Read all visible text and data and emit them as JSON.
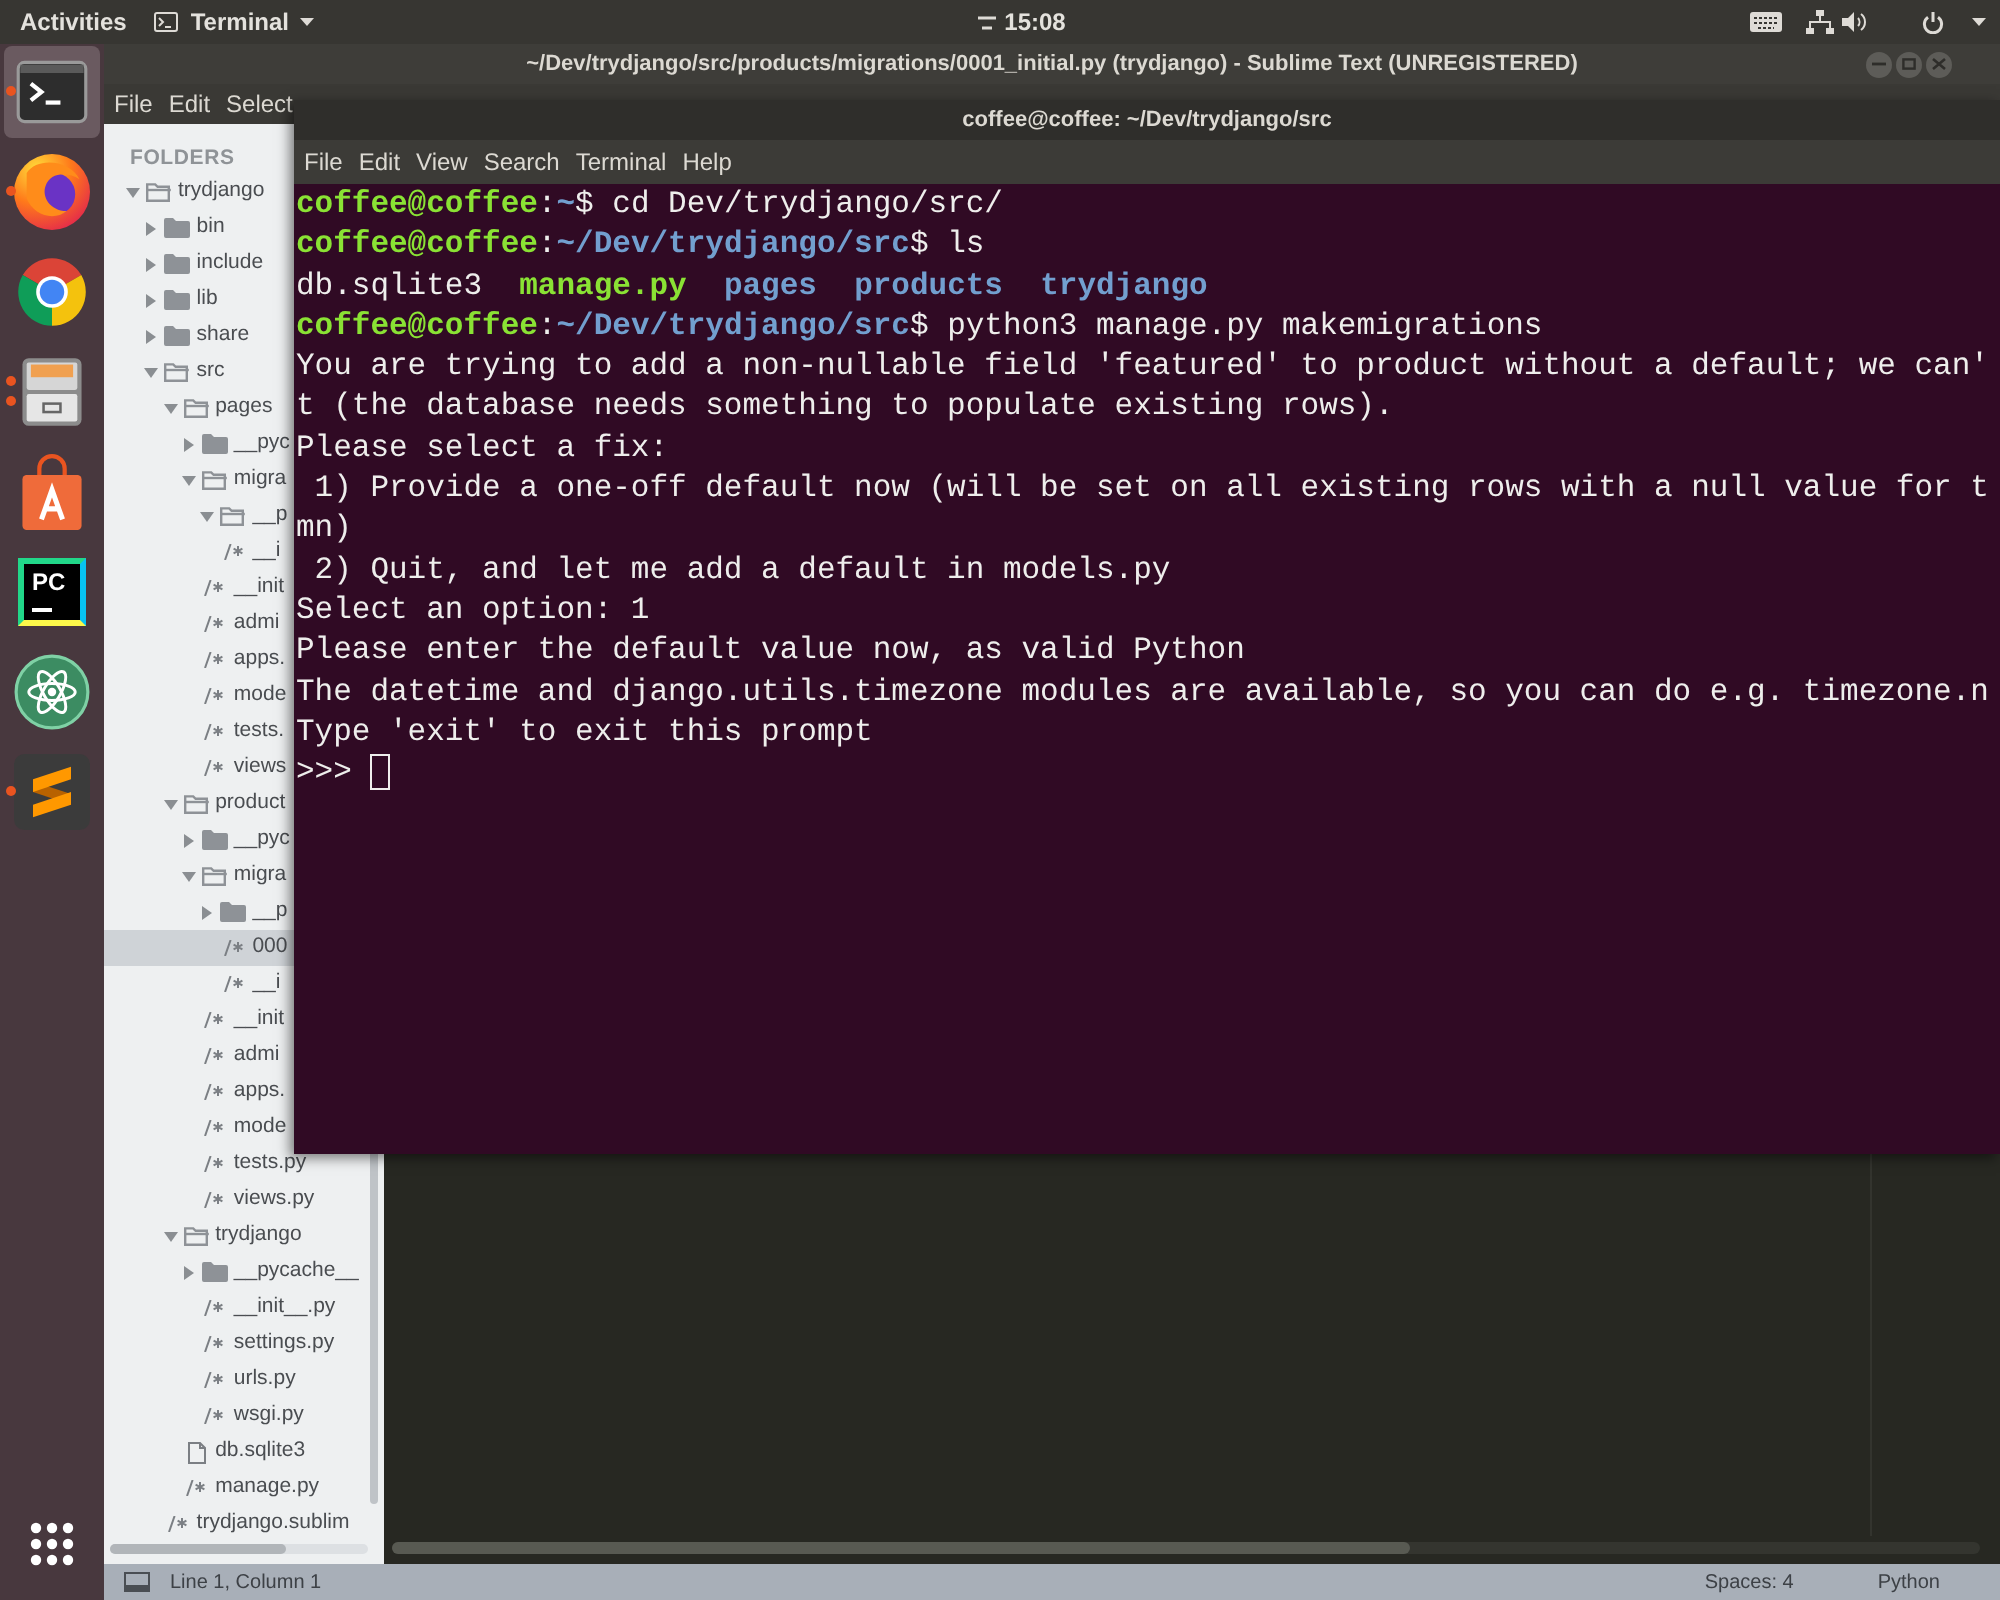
{
  "top_bar": {
    "activities": "Activities",
    "app_menu": "Terminal",
    "clock": "15:08"
  },
  "dock": {
    "items": [
      {
        "kind": "terminal",
        "selected": true,
        "running": true,
        "multiple": false
      },
      {
        "kind": "firefox",
        "selected": false,
        "running": true,
        "multiple": false
      },
      {
        "kind": "chrome",
        "selected": false,
        "running": false
      },
      {
        "kind": "files",
        "selected": false,
        "running": true,
        "multiple": true
      },
      {
        "kind": "software",
        "selected": false,
        "running": false
      },
      {
        "kind": "pycharm",
        "selected": false,
        "running": false,
        "logo_text": "PC"
      },
      {
        "kind": "atom",
        "selected": false,
        "running": false
      },
      {
        "kind": "sublime",
        "selected": false,
        "running": true,
        "multiple": false
      }
    ]
  },
  "editor_window": {
    "title": "~/Dev/trydjango/src/products/migrations/0001_initial.py (trydjango) - Sublime Text (UNREGISTERED)",
    "menu": [
      "File",
      "Edit",
      "Select"
    ],
    "sidebar": {
      "header": "FOLDERS",
      "tree": [
        {
          "label": "trydjango",
          "kind": "folder",
          "expanded": true,
          "selected": false,
          "children": [
            {
              "label": "bin",
              "kind": "folder",
              "expanded": false,
              "selected": false
            },
            {
              "label": "include",
              "kind": "folder",
              "expanded": false,
              "selected": false
            },
            {
              "label": "lib",
              "kind": "folder",
              "expanded": false,
              "selected": false
            },
            {
              "label": "share",
              "kind": "folder",
              "expanded": false,
              "selected": false
            },
            {
              "label": "src",
              "kind": "folder",
              "expanded": true,
              "selected": false,
              "children": [
                {
                  "label": "pages",
                  "kind": "folder",
                  "expanded": true,
                  "selected": false,
                  "children": [
                    {
                      "label": "__pyc",
                      "kind": "folder",
                      "expanded": false,
                      "selected": false
                    },
                    {
                      "label": "migra",
                      "kind": "folder",
                      "expanded": true,
                      "selected": false,
                      "children": [
                        {
                          "label": "__p",
                          "kind": "folder",
                          "expanded": true,
                          "selected": false
                        },
                        {
                          "label": "__i",
                          "kind": "code",
                          "selected": false
                        }
                      ]
                    },
                    {
                      "label": "__init",
                      "kind": "code",
                      "selected": false
                    },
                    {
                      "label": "admi",
                      "kind": "code",
                      "selected": false
                    },
                    {
                      "label": "apps.",
                      "kind": "code",
                      "selected": false
                    },
                    {
                      "label": "mode",
                      "kind": "code",
                      "selected": false
                    },
                    {
                      "label": "tests.",
                      "kind": "code",
                      "selected": false
                    },
                    {
                      "label": "views",
                      "kind": "code",
                      "selected": false
                    }
                  ]
                },
                {
                  "label": "product",
                  "kind": "folder",
                  "expanded": true,
                  "selected": false,
                  "children": [
                    {
                      "label": "__pyc",
                      "kind": "folder",
                      "expanded": false,
                      "selected": false
                    },
                    {
                      "label": "migra",
                      "kind": "folder",
                      "expanded": true,
                      "selected": false,
                      "children": [
                        {
                          "label": "__p",
                          "kind": "folder",
                          "expanded": false,
                          "selected": false
                        },
                        {
                          "label": "000",
                          "kind": "code",
                          "selected": true
                        },
                        {
                          "label": "__i",
                          "kind": "code",
                          "selected": false
                        }
                      ]
                    },
                    {
                      "label": "__init",
                      "kind": "code",
                      "selected": false
                    },
                    {
                      "label": "admi",
                      "kind": "code",
                      "selected": false
                    },
                    {
                      "label": "apps.",
                      "kind": "code",
                      "selected": false
                    },
                    {
                      "label": "mode",
                      "kind": "code",
                      "selected": false
                    },
                    {
                      "label": "tests.py",
                      "kind": "code",
                      "selected": false
                    },
                    {
                      "label": "views.py",
                      "kind": "code",
                      "selected": false
                    }
                  ]
                },
                {
                  "label": "trydjango",
                  "kind": "folder",
                  "expanded": true,
                  "selected": false,
                  "children": [
                    {
                      "label": "__pycache__",
                      "kind": "folder",
                      "expanded": false,
                      "selected": false
                    },
                    {
                      "label": "__init__.py",
                      "kind": "code",
                      "selected": false
                    },
                    {
                      "label": "settings.py",
                      "kind": "code",
                      "selected": false
                    },
                    {
                      "label": "urls.py",
                      "kind": "code",
                      "selected": false
                    },
                    {
                      "label": "wsgi.py",
                      "kind": "code",
                      "selected": false
                    }
                  ]
                },
                {
                  "label": "db.sqlite3",
                  "kind": "data",
                  "selected": false
                },
                {
                  "label": "manage.py",
                  "kind": "code",
                  "selected": false
                }
              ]
            },
            {
              "label": "trydjango.sublim",
              "kind": "code",
              "selected": false
            }
          ]
        }
      ]
    },
    "status_bar": {
      "position": "Line 1, Column 1",
      "indentation": "Spaces: 4",
      "syntax": "Python"
    }
  },
  "terminal": {
    "title": "coffee@coffee: ~/Dev/trydjango/src",
    "menu": [
      "File",
      "Edit",
      "View",
      "Search",
      "Terminal",
      "Help"
    ],
    "lines": [
      [
        {
          "text": "coffee@coffee",
          "kind": "user"
        },
        {
          "text": ":",
          "kind": "plain"
        },
        {
          "text": "~",
          "kind": "path"
        },
        {
          "text": "$ cd Dev/trydjango/src/",
          "kind": "plain"
        }
      ],
      [
        {
          "text": "coffee@coffee",
          "kind": "user"
        },
        {
          "text": ":",
          "kind": "plain"
        },
        {
          "text": "~/Dev/trydjango/src",
          "kind": "path"
        },
        {
          "text": "$ ls",
          "kind": "plain"
        }
      ],
      [
        {
          "text": "db.sqlite3  ",
          "kind": "plain"
        },
        {
          "text": "manage.py",
          "kind": "exec"
        },
        {
          "text": "  pages",
          "kind": "dir"
        },
        {
          "text": "  products",
          "kind": "dir"
        },
        {
          "text": "  trydjango",
          "kind": "dir"
        }
      ],
      [
        {
          "text": "coffee@coffee",
          "kind": "user"
        },
        {
          "text": ":",
          "kind": "plain"
        },
        {
          "text": "~/Dev/trydjango/src",
          "kind": "path"
        },
        {
          "text": "$ python3 manage.py makemigrations",
          "kind": "plain"
        }
      ],
      [
        {
          "text": "You are trying to add a non-nullable field 'featured' to product without a default; we can'",
          "kind": "plain"
        }
      ],
      [
        {
          "text": "t (the database needs something to populate existing rows).",
          "kind": "plain"
        }
      ],
      [
        {
          "text": "Please select a fix:",
          "kind": "plain"
        }
      ],
      [
        {
          "text": " 1) Provide a one-off default now (will be set on all existing rows with a null value for t",
          "kind": "plain"
        }
      ],
      [
        {
          "text": "mn)",
          "kind": "plain"
        }
      ],
      [
        {
          "text": " 2) Quit, and let me add a default in models.py",
          "kind": "plain"
        }
      ],
      [
        {
          "text": "Select an option: 1",
          "kind": "plain"
        }
      ],
      [
        {
          "text": "Please enter the default value now, as valid Python",
          "kind": "plain"
        }
      ],
      [
        {
          "text": "The datetime and django.utils.timezone modules are available, so you can do e.g. timezone.n",
          "kind": "plain"
        }
      ],
      [
        {
          "text": "Type 'exit' to exit this prompt",
          "kind": "plain"
        }
      ],
      [
        {
          "text": ">>> ",
          "kind": "plain"
        }
      ]
    ],
    "cursor": true
  }
}
